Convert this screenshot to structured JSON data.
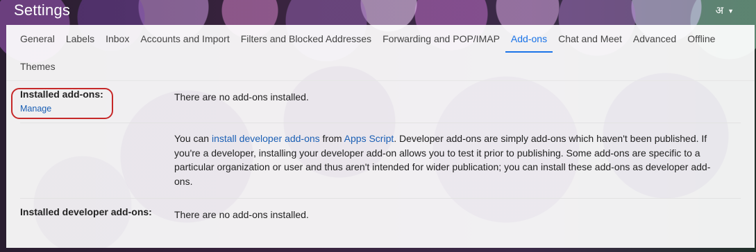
{
  "header": {
    "title": "Settings",
    "lang_glyph": "अ"
  },
  "tabs": [
    {
      "label": "General"
    },
    {
      "label": "Labels"
    },
    {
      "label": "Inbox"
    },
    {
      "label": "Accounts and Import"
    },
    {
      "label": "Filters and Blocked Addresses"
    },
    {
      "label": "Forwarding and POP/IMAP"
    },
    {
      "label": "Add-ons",
      "active": true
    },
    {
      "label": "Chat and Meet"
    },
    {
      "label": "Advanced"
    },
    {
      "label": "Offline"
    },
    {
      "label": "Themes"
    }
  ],
  "installed": {
    "label": "Installed add-ons:",
    "manage": "Manage",
    "status": "There are no add-ons installed."
  },
  "developer_info": {
    "prefix": "You can ",
    "link1": "install developer add-ons",
    "mid": " from ",
    "link2": "Apps Script",
    "suffix": ". Developer add-ons are simply add-ons which haven't been published. If you're a developer, installing your developer add-on allows you to test it prior to publishing. Some add-ons are specific to a particular organization or user and thus aren't intended for wider publication; you can install these add-ons as developer add-ons."
  },
  "developer": {
    "label": "Installed developer add-ons:",
    "status": "There are no add-ons installed."
  },
  "colors": {
    "accent": "#1a73e8",
    "link": "#1a5fb4",
    "highlight_circle": "#c62828"
  }
}
